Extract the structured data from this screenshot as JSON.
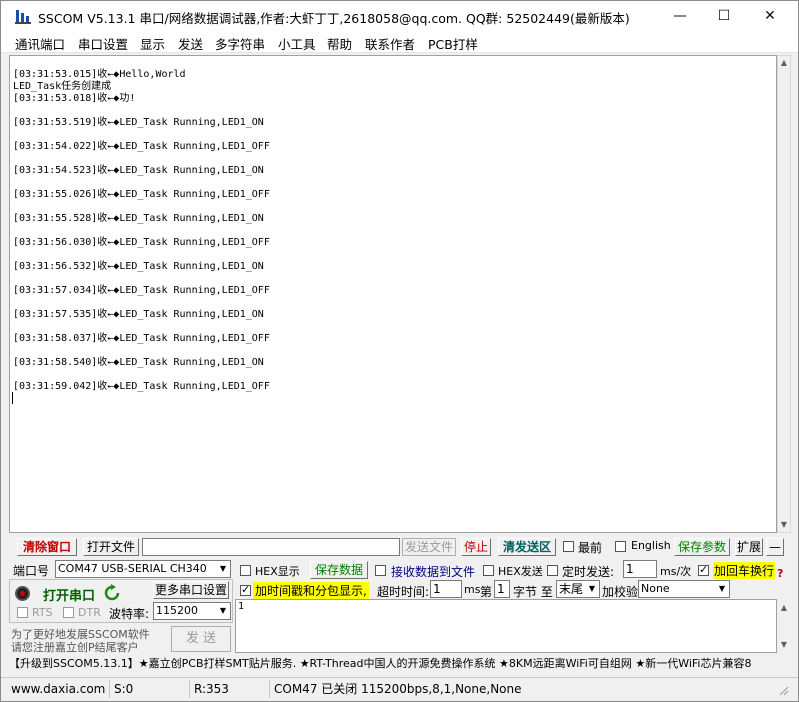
{
  "window": {
    "title": "SSCOM V5.13.1 串口/网络数据调试器,作者:大虾丁丁,2618058@qq.com. QQ群: 52502449(最新版本)",
    "minimize": "—",
    "maximize": "☐",
    "close": "✕"
  },
  "menu": [
    "通讯端口",
    "串口设置",
    "显示",
    "发送",
    "多字符串",
    "小工具",
    "帮助",
    "联系作者",
    "PCB打样"
  ],
  "log": {
    "lines": [
      "[03:31:53.015]收←◆Hello,World",
      "LED_Task任务创建成",
      "[03:31:53.018]收←◆功!",
      "",
      "[03:31:53.519]收←◆LED_Task Running,LED1_ON",
      "",
      "[03:31:54.022]收←◆LED_Task Running,LED1_OFF",
      "",
      "[03:31:54.523]收←◆LED_Task Running,LED1_ON",
      "",
      "[03:31:55.026]收←◆LED_Task Running,LED1_OFF",
      "",
      "[03:31:55.528]收←◆LED_Task Running,LED1_ON",
      "",
      "[03:31:56.030]收←◆LED_Task Running,LED1_OFF",
      "",
      "[03:31:56.532]收←◆LED_Task Running,LED1_ON",
      "",
      "[03:31:57.034]收←◆LED_Task Running,LED1_OFF",
      "",
      "[03:31:57.535]收←◆LED_Task Running,LED1_ON",
      "",
      "[03:31:58.037]收←◆LED_Task Running,LED1_OFF",
      "",
      "[03:31:58.540]收←◆LED_Task Running,LED1_ON",
      "",
      "[03:31:59.042]收←◆LED_Task Running,LED1_OFF"
    ]
  },
  "toolbar": {
    "clear_window": "清除窗口",
    "open_file": "打开文件",
    "file_path": "",
    "send_file": "发送文件",
    "stop": "停止",
    "clear_send": "清发送区",
    "topmost": "最前",
    "english": "English",
    "save_params": "保存参数",
    "expand": "扩展",
    "collapse": "—"
  },
  "port": {
    "port_label": "端口号",
    "port_value": "COM47 USB-SERIAL CH340",
    "open_port": "打开串口",
    "more_settings": "更多串口设置",
    "rts": "RTS",
    "dtr": "DTR",
    "baud_label": "波特率:",
    "baud_value": "115200",
    "promo_line1": "为了更好地发展SSCOM软件",
    "promo_line2": "请您注册嘉立创P结尾客户",
    "send_btn": "发 送"
  },
  "options": {
    "hex_display": "HEX显示",
    "save_data": "保存数据",
    "recv_to_file": "接收数据到文件",
    "hex_send": "HEX发送",
    "timed_send": "定时发送:",
    "timed_value": "1",
    "ms_per": "ms/次",
    "add_crlf": "加回车换行",
    "add_timestamp": "加时间戳和分包显示,",
    "timeout_label": "超时时间:",
    "timeout_value": "1",
    "ms": "ms",
    "nth": "第",
    "nth_value": "1",
    "byte_label": "字节 至",
    "end_value": "末尾",
    "checksum_label": "加校验",
    "checksum_value": "None",
    "help": "?"
  },
  "send_area": {
    "text": "1"
  },
  "ticker": "【升级到SSCOM5.13.1】★嘉立创PCB打样SMT贴片服务. ★RT-Thread中国人的开源免费操作系统 ★8KM远距离WiFi可自组网 ★新一代WiFi芯片兼容8",
  "status": {
    "site": "www.daxia.com",
    "sent": "S:0",
    "received": "R:353",
    "port_state": "COM47 已关闭  115200bps,8,1,None,None"
  }
}
